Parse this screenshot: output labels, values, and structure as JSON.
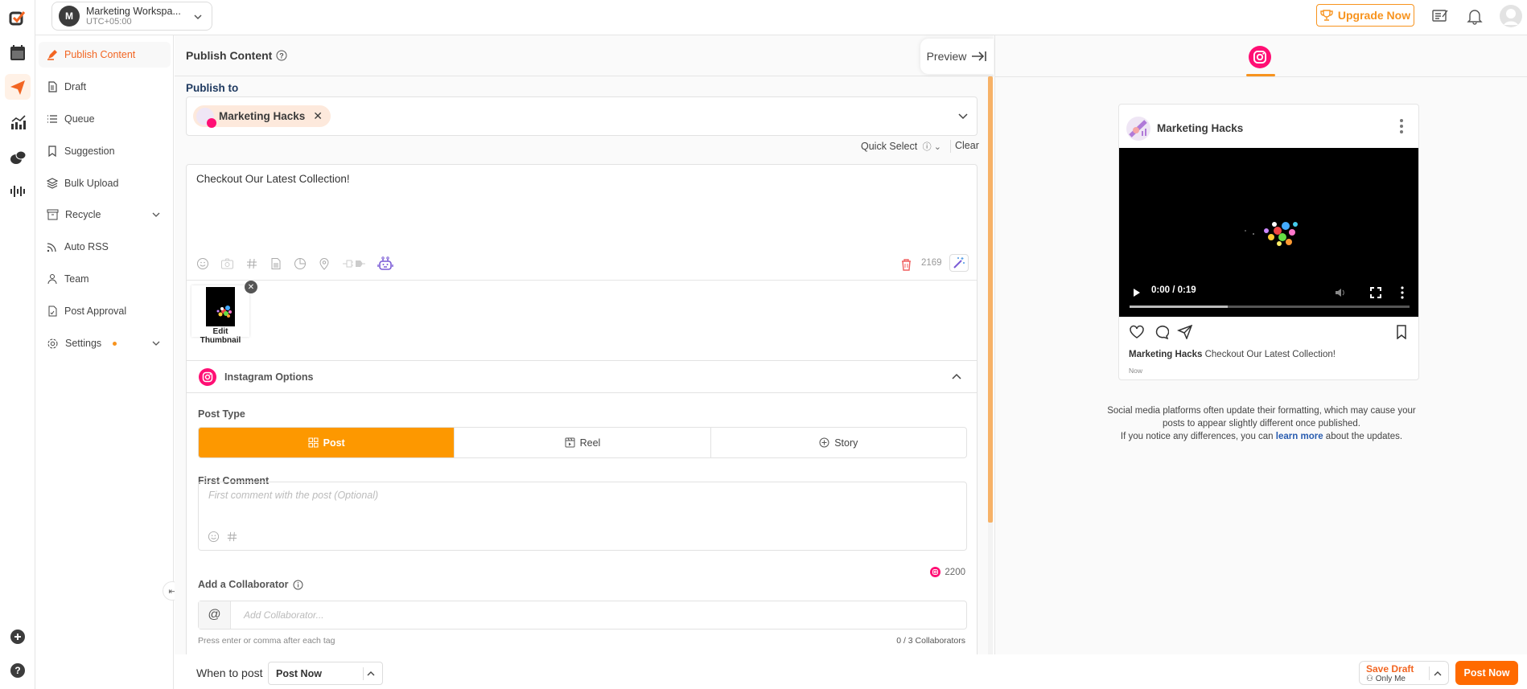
{
  "topbar": {
    "workspace_initial": "M",
    "workspace_name": "Marketing Workspa...",
    "workspace_timezone": "UTC+05:00",
    "upgrade_label": "Upgrade Now"
  },
  "rail": {
    "items": [
      {
        "icon": "logo-icon"
      },
      {
        "icon": "calendar-icon"
      },
      {
        "icon": "send-icon",
        "active": true
      },
      {
        "icon": "analytics-icon"
      },
      {
        "icon": "chat-icon"
      },
      {
        "icon": "audio-wave-icon"
      }
    ],
    "bottom": [
      {
        "icon": "add-icon"
      },
      {
        "icon": "help-icon"
      }
    ]
  },
  "sidebar": {
    "items": [
      {
        "label": "Publish Content",
        "icon": "pencil-icon",
        "active": true
      },
      {
        "label": "Draft",
        "icon": "document-icon"
      },
      {
        "label": "Queue",
        "icon": "list-icon"
      },
      {
        "label": "Suggestion",
        "icon": "bookmark-icon"
      },
      {
        "label": "Bulk Upload",
        "icon": "layers-icon"
      },
      {
        "label": "Recycle",
        "icon": "archive-icon",
        "expandable": true
      },
      {
        "label": "Auto RSS",
        "icon": "rss-icon"
      },
      {
        "label": "Team",
        "icon": "user-icon"
      },
      {
        "label": "Post Approval",
        "icon": "approval-icon"
      },
      {
        "label": "Settings",
        "icon": "gear-icon",
        "expandable": true,
        "dot": true
      }
    ]
  },
  "main": {
    "title": "Publish Content",
    "preview_label": "Preview",
    "publish_to_label": "Publish to",
    "selected_account": "Marketing Hacks",
    "quick_select_label": "Quick Select",
    "clear_label": "Clear",
    "post_text": "Checkout Our Latest Collection!",
    "char_count": "2169",
    "thumbnail_label": "Edit Thumbnail",
    "instagram_options": {
      "title": "Instagram Options",
      "post_type_label": "Post Type",
      "post_types": [
        {
          "label": "Post",
          "icon": "grid-icon",
          "selected": true
        },
        {
          "label": "Reel",
          "icon": "reel-icon",
          "selected": false
        },
        {
          "label": "Story",
          "icon": "plus-circle-icon",
          "selected": false
        }
      ],
      "first_comment_label": "First Comment",
      "first_comment_placeholder": "First comment with the post (Optional)",
      "comment_char_count": "2200",
      "collaborator_label": "Add a Collaborator",
      "collaborator_placeholder": "Add Collaborator...",
      "collaborator_hint": "Press enter or comma after each tag",
      "collaborator_count": "0 / 3 Collaborators"
    }
  },
  "bottombar": {
    "when_label": "When to post",
    "when_value": "Post Now",
    "save_draft_label": "Save Draft",
    "save_draft_visibility": "Only Me",
    "post_now_label": "Post Now"
  },
  "preview": {
    "account_name": "Marketing Hacks",
    "video_time": "0:00 / 0:19",
    "video_progress": 0.35,
    "caption_name": "Marketing Hacks",
    "caption_text": "Checkout Our Latest Collection!",
    "timestamp": "Now",
    "note_line1": "Social media platforms often update their formatting, which may cause your",
    "note_line2": "posts to appear slightly different once published.",
    "note_line3_pre": "If you notice any differences, you can",
    "note_link": "learn more",
    "note_line3_post": "about the updates."
  },
  "colors": {
    "accent": "#f26522",
    "orange": "#fd9800",
    "instagram": "#ff0f74",
    "link": "#2a5db0"
  }
}
